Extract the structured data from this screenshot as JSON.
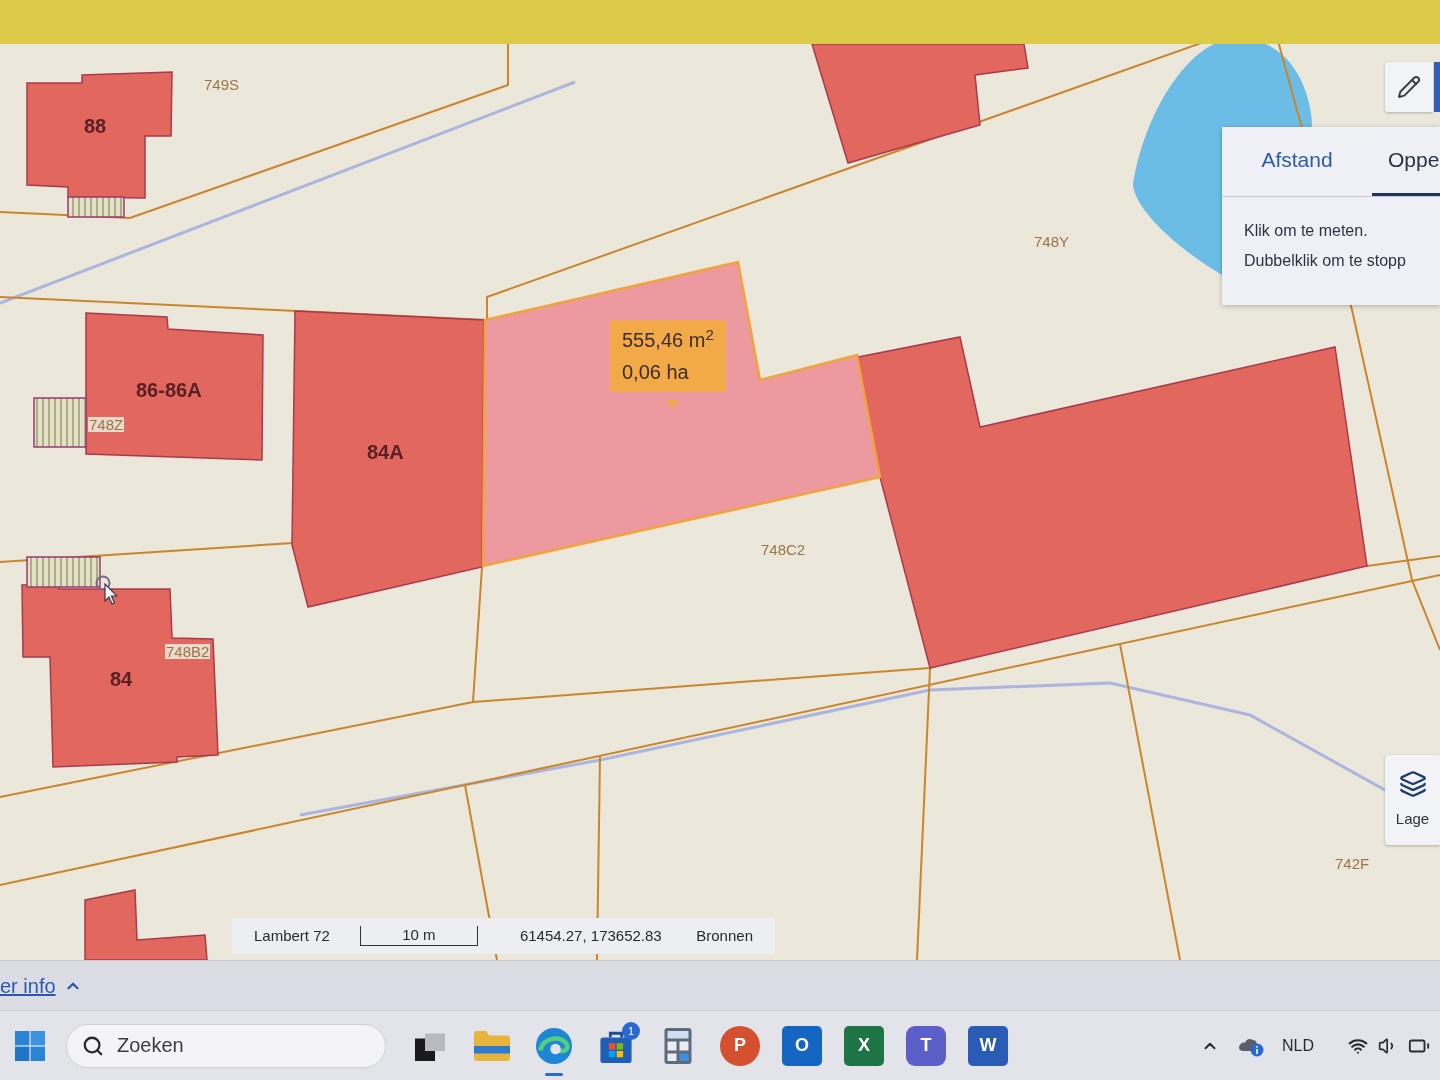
{
  "map": {
    "labels": [
      {
        "kind": "parcel",
        "text": "749S"
      },
      {
        "kind": "building",
        "text": "88"
      },
      {
        "kind": "building",
        "text": "86-86A"
      },
      {
        "kind": "parcel",
        "text": "748Z"
      },
      {
        "kind": "building",
        "text": "84A"
      },
      {
        "kind": "parcel",
        "text": "748Y"
      },
      {
        "kind": "parcel",
        "text": "748C2"
      },
      {
        "kind": "building",
        "text": "84"
      },
      {
        "kind": "parcel",
        "text": "748B2"
      },
      {
        "kind": "parcel",
        "text": "742F"
      }
    ],
    "measurement": {
      "area": "555,46 m$^{2}$",
      "hectares": "0,06 ha"
    }
  },
  "measure_panel": {
    "tabs": [
      {
        "label": "Afstand",
        "selected": false
      },
      {
        "label": "Oppe",
        "selected": true
      }
    ],
    "instructions": [
      "Klik om te meten.",
      "Dubbelklik om te stopp"
    ]
  },
  "layers_button": {
    "label": "Lage"
  },
  "status_bar": {
    "projection": "Lambert 72",
    "scale": "10 m",
    "coordinates": "61454.27, 173652.83",
    "sources": "Bronnen"
  },
  "info_link": {
    "label": "er info"
  },
  "taskbar": {
    "search": {
      "placeholder": "Zoeken"
    },
    "apps": [
      {
        "kind": "taskview",
        "selected": false
      },
      {
        "kind": "files",
        "selected": false
      },
      {
        "kind": "browser",
        "selected": true
      },
      {
        "kind": "store",
        "badge": "1",
        "selected": false
      },
      {
        "kind": "calculator",
        "selected": false
      },
      {
        "kind": "presentation",
        "letter": "P",
        "selected": false
      },
      {
        "kind": "mail",
        "letter": "O",
        "selected": false
      },
      {
        "kind": "spreadsheet",
        "letter": "X",
        "selected": false
      },
      {
        "kind": "chat",
        "letter": "T",
        "selected": false
      },
      {
        "kind": "document",
        "letter": "W",
        "selected": false
      }
    ],
    "tray": {
      "language": "NLD"
    }
  }
}
